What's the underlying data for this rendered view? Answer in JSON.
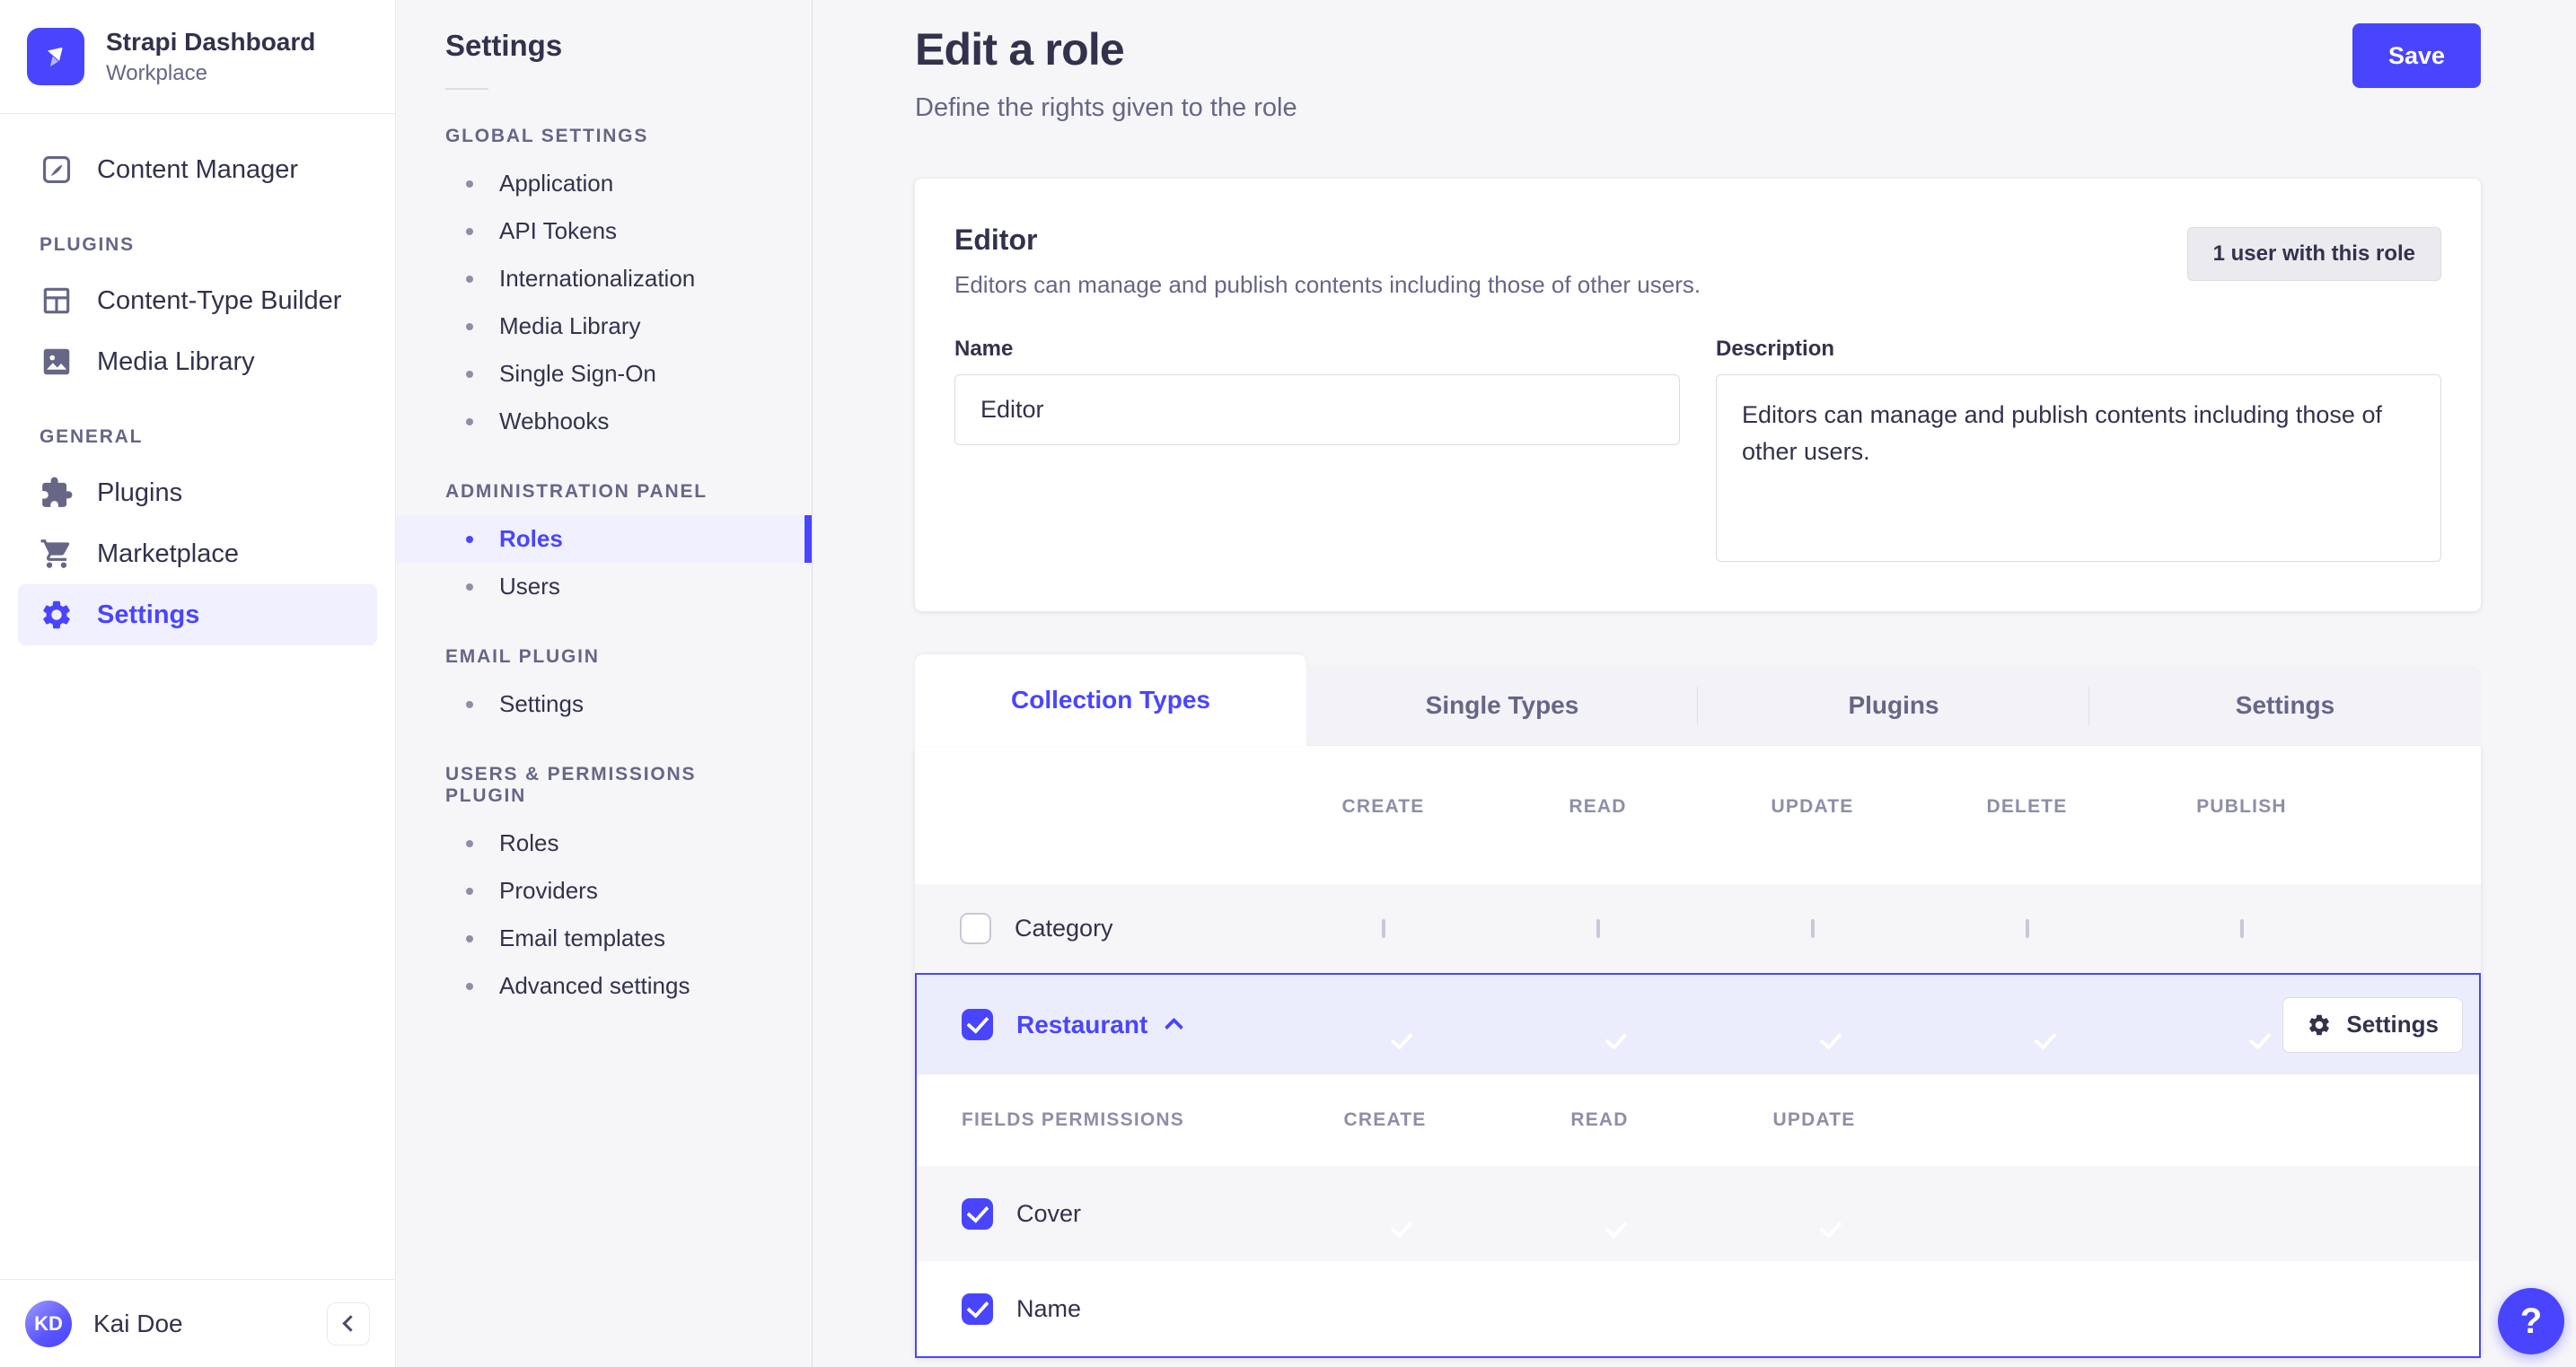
{
  "colors": {
    "accent": "#4945ff",
    "accent_light_bg": "#f0f0ff",
    "selected_row_bg": "#ecedfc",
    "text_dark": "#32324d",
    "text_gray": "#666687",
    "page_bg": "#f6f6f9"
  },
  "sidebar": {
    "brand": {
      "name": "Strapi Dashboard",
      "workspace": "Workplace"
    },
    "main_item": "Content Manager",
    "sections": [
      {
        "label": "PLUGINS",
        "items": [
          {
            "label": "Content-Type Builder"
          },
          {
            "label": "Media Library"
          }
        ]
      },
      {
        "label": "GENERAL",
        "items": [
          {
            "label": "Plugins"
          },
          {
            "label": "Marketplace"
          },
          {
            "label": "Settings",
            "active": true
          }
        ]
      }
    ],
    "user": {
      "initials": "KD",
      "name": "Kai Doe"
    }
  },
  "subnav": {
    "title": "Settings",
    "sections": [
      {
        "label": "GLOBAL SETTINGS",
        "items": [
          {
            "label": "Application"
          },
          {
            "label": "API Tokens"
          },
          {
            "label": "Internationalization"
          },
          {
            "label": "Media Library"
          },
          {
            "label": "Single Sign-On"
          },
          {
            "label": "Webhooks"
          }
        ]
      },
      {
        "label": "ADMINISTRATION PANEL",
        "items": [
          {
            "label": "Roles",
            "active": true
          },
          {
            "label": "Users"
          }
        ]
      },
      {
        "label": "EMAIL PLUGIN",
        "items": [
          {
            "label": "Settings"
          }
        ]
      },
      {
        "label": "USERS & PERMISSIONS PLUGIN",
        "items": [
          {
            "label": "Roles"
          },
          {
            "label": "Providers"
          },
          {
            "label": "Email templates"
          },
          {
            "label": "Advanced settings"
          }
        ]
      }
    ]
  },
  "header": {
    "title": "Edit a role",
    "subtitle": "Define the rights given to the role",
    "save_label": "Save"
  },
  "role_card": {
    "title": "Editor",
    "subtitle": "Editors can manage and publish contents including those of other users.",
    "users_badge": "1 user with this role",
    "name_label": "Name",
    "name_value": "Editor",
    "description_label": "Description",
    "description_value": "Editors can manage and publish contents including those of other users."
  },
  "tabs": [
    {
      "label": "Collection Types",
      "active": true
    },
    {
      "label": "Single Types",
      "active": false
    },
    {
      "label": "Plugins",
      "active": false
    },
    {
      "label": "Settings",
      "active": false
    }
  ],
  "permissions": {
    "columns": [
      "CREATE",
      "READ",
      "UPDATE",
      "DELETE",
      "PUBLISH"
    ],
    "select_all_state": "indeterminate",
    "rows": [
      {
        "label": "Category",
        "checked": false,
        "expanded": false,
        "cells": [
          "unchecked",
          "unchecked",
          "unchecked",
          "unchecked",
          "unchecked"
        ]
      },
      {
        "label": "Restaurant",
        "checked": true,
        "expanded": true,
        "cells": [
          "checked",
          "checked",
          "checked",
          "checked",
          "checked"
        ],
        "settings_label": "Settings"
      }
    ],
    "fields": {
      "header": "FIELDS PERMISSIONS",
      "columns": [
        "CREATE",
        "READ",
        "UPDATE"
      ],
      "rows": [
        {
          "label": "Cover",
          "checked": true,
          "cells": [
            "checked",
            "checked",
            "checked"
          ]
        },
        {
          "label": "Name",
          "checked": true,
          "cells": [
            "checked",
            "checked",
            "checked"
          ]
        }
      ]
    }
  },
  "help": {
    "label": "?"
  }
}
